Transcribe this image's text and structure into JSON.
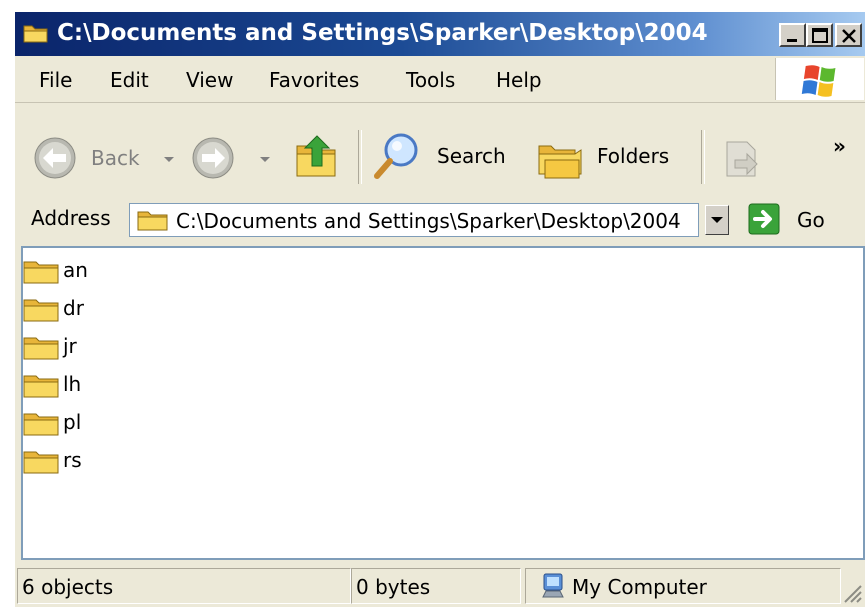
{
  "window": {
    "title": "C:\\Documents and Settings\\Sparker\\Desktop\\2004"
  },
  "menu": {
    "items": [
      "File",
      "Edit",
      "View",
      "Favorites",
      "Tools",
      "Help"
    ]
  },
  "toolbar": {
    "back_label": "Back",
    "search_label": "Search",
    "folders_label": "Folders",
    "overflow_label": "»"
  },
  "address": {
    "label": "Address",
    "path": "C:\\Documents and Settings\\Sparker\\Desktop\\2004",
    "go_label": "Go"
  },
  "folders": [
    "an",
    "dr",
    "jr",
    "lh",
    "pl",
    "rs"
  ],
  "status": {
    "objects": "6 objects",
    "size": "0 bytes",
    "zone": "My Computer"
  },
  "colors": {
    "titlebar_start": "#0a246a",
    "titlebar_end": "#a6caf0",
    "window_face": "#ece9d8",
    "folder_yellow": "#f5c842",
    "go_green": "#3aa33a"
  },
  "icons": {
    "title": "folder-icon",
    "back": "back-arrow-icon",
    "forward": "forward-arrow-icon",
    "up": "up-folder-icon",
    "search": "search-magnifier-icon",
    "folders": "folders-icon",
    "go": "go-arrow-icon",
    "zone": "my-computer-icon"
  }
}
